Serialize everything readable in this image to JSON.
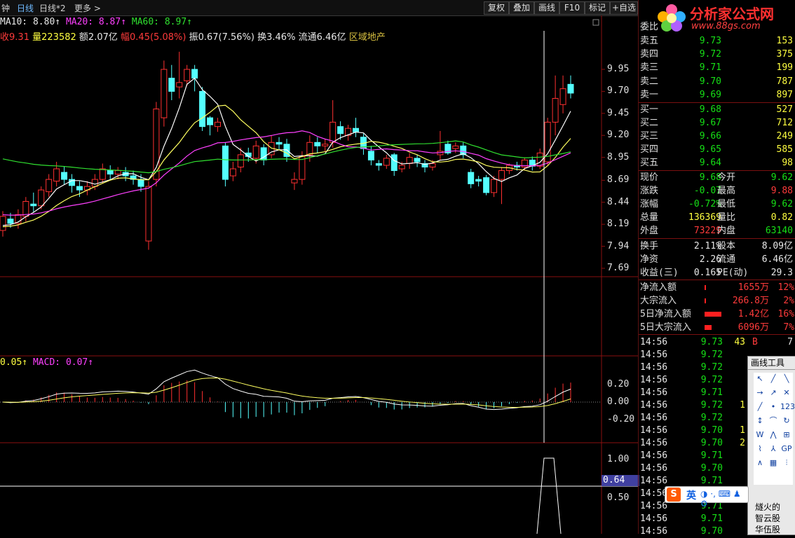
{
  "topbar": {
    "tab_minute": "钟",
    "tab_day": "日线",
    "tab_dayx2": "日线*2",
    "more": "更多 >",
    "buttons": [
      "复权",
      "叠加",
      "画线",
      "F10",
      "标记",
      "+自选"
    ]
  },
  "ma_line": {
    "ma10_label": "MA10:",
    "ma10_value": "8.80↑",
    "ma20_label": "MA20:",
    "ma20_value": "8.87↑",
    "ma60_label": "MA60:",
    "ma60_value": "8.97↑"
  },
  "stat_line": {
    "close_label": "收",
    "close_value": "9.31",
    "vol_label": "量",
    "vol_value": "223582",
    "amt_label": "额",
    "amt_value": "2.07亿",
    "chg_label": "幅",
    "chg_value": "0.45(5.08%)",
    "amp_label": "振",
    "amp_value": "0.67(7.56%)",
    "turn_label": "换",
    "turn_value": "3.46%",
    "float_label": "流通",
    "float_value": "6.46亿",
    "sector": "区域地产"
  },
  "macd_line": {
    "left": "0.05↑",
    "label": "MACD:",
    "value": "0.07↑"
  },
  "price_axis": [
    "9.95",
    "9.70",
    "9.45",
    "9.20",
    "8.95",
    "8.69",
    "8.44",
    "8.19",
    "7.94",
    "7.69"
  ],
  "macd_axis": [
    "0.20",
    "0.00",
    "-0.20"
  ],
  "bottom_axis": [
    "1.00",
    "0.64",
    "0.50"
  ],
  "logo": {
    "title": "分析家公式网",
    "url": "www.88gs.com"
  },
  "panel": {
    "header": "委比",
    "sells": [
      {
        "label": "卖五",
        "price": "9.73",
        "vol": "153"
      },
      {
        "label": "卖四",
        "price": "9.72",
        "vol": "375"
      },
      {
        "label": "卖三",
        "price": "9.71",
        "vol": "199"
      },
      {
        "label": "卖二",
        "price": "9.70",
        "vol": "787"
      },
      {
        "label": "卖一",
        "price": "9.69",
        "vol": "897"
      }
    ],
    "buys": [
      {
        "label": "买一",
        "price": "9.68",
        "vol": "527"
      },
      {
        "label": "买二",
        "price": "9.67",
        "vol": "712"
      },
      {
        "label": "买三",
        "price": "9.66",
        "vol": "249"
      },
      {
        "label": "买四",
        "price": "9.65",
        "vol": "585"
      },
      {
        "label": "买五",
        "price": "9.64",
        "vol": "98"
      }
    ],
    "quote": [
      {
        "l1": "现价",
        "v1": "9.68",
        "c1": "green",
        "l2": "今开",
        "v2": "9.62",
        "c2": "green"
      },
      {
        "l1": "涨跌",
        "v1": "-0.07",
        "c1": "green",
        "l2": "最高",
        "v2": "9.88",
        "c2": "red"
      },
      {
        "l1": "涨幅",
        "v1": "-0.72%",
        "c1": "green",
        "l2": "最低",
        "v2": "9.62",
        "c2": "green"
      },
      {
        "l1": "总量",
        "v1": "136369",
        "c1": "yellow",
        "l2": "量比",
        "v2": "0.82",
        "c2": "yellow"
      },
      {
        "l1": "外盘",
        "v1": "73229",
        "c1": "red",
        "l2": "内盘",
        "v2": "63140",
        "c2": "green"
      }
    ],
    "fund": [
      {
        "l1": "换手",
        "v1": "2.11%",
        "l2": "股本",
        "v2": "8.09亿"
      },
      {
        "l1": "净资",
        "v1": "2.26",
        "l2": "流通",
        "v2": "6.46亿"
      },
      {
        "l1": "收益(三)",
        "v1": "0.165",
        "l2": "PE(动)",
        "v2": "29.3"
      }
    ],
    "flows": [
      {
        "label": "净流入额",
        "value": "1655万",
        "pct": "12%"
      },
      {
        "label": "大宗流入",
        "value": "266.8万",
        "pct": "2%"
      },
      {
        "label": "5日净流入额",
        "value": "1.42亿",
        "pct": "16%"
      },
      {
        "label": "5日大宗流入",
        "value": "6096万",
        "pct": "7%"
      }
    ],
    "ticks": [
      {
        "t": "14:56",
        "p": "9.73",
        "v": "43",
        "f": "B",
        "e": "7"
      },
      {
        "t": "14:56",
        "p": "9.72",
        "v": "",
        "f": "",
        "e": ""
      },
      {
        "t": "14:56",
        "p": "9.72",
        "v": "",
        "f": "",
        "e": ""
      },
      {
        "t": "14:56",
        "p": "9.72",
        "v": "",
        "f": "",
        "e": ""
      },
      {
        "t": "14:56",
        "p": "9.71",
        "v": "",
        "f": "",
        "e": ""
      },
      {
        "t": "14:56",
        "p": "9.72",
        "v": "1",
        "f": "",
        "e": ""
      },
      {
        "t": "14:56",
        "p": "9.72",
        "v": "",
        "f": "",
        "e": ""
      },
      {
        "t": "14:56",
        "p": "9.70",
        "v": "1",
        "f": "",
        "e": ""
      },
      {
        "t": "14:56",
        "p": "9.70",
        "v": "2",
        "f": "",
        "e": ""
      },
      {
        "t": "14:56",
        "p": "9.71",
        "v": "",
        "f": "",
        "e": ""
      },
      {
        "t": "14:56",
        "p": "9.70",
        "v": "",
        "f": "",
        "e": ""
      },
      {
        "t": "14:56",
        "p": "9.71",
        "v": "",
        "f": "",
        "e": ""
      },
      {
        "t": "14:56",
        "p": "9.70",
        "v": "",
        "f": "",
        "e": ""
      },
      {
        "t": "14:56",
        "p": "9.71",
        "v": "",
        "f": "",
        "e": ""
      },
      {
        "t": "14:56",
        "p": "9.71",
        "v": "",
        "f": "",
        "e": ""
      },
      {
        "t": "14:56",
        "p": "9.70",
        "v": "",
        "f": "",
        "e": ""
      }
    ]
  },
  "toolbox": {
    "title": "画线工具",
    "stocks": [
      "燧火的",
      "智云股",
      "华伍股"
    ]
  },
  "ime": {
    "label": "英"
  },
  "chart_data": {
    "type": "candlestick",
    "price_axis_ticks": [
      9.95,
      9.7,
      9.45,
      9.2,
      8.95,
      8.69,
      8.44,
      8.19,
      7.94,
      7.69
    ],
    "ylim": [
      7.6,
      10.2
    ],
    "candles": [
      [
        8.12,
        8.28,
        8.05,
        8.34
      ],
      [
        8.25,
        8.2,
        8.15,
        8.32
      ],
      [
        8.2,
        8.3,
        8.14,
        8.36
      ],
      [
        8.28,
        8.45,
        8.22,
        8.5
      ],
      [
        8.42,
        8.4,
        8.32,
        8.55
      ],
      [
        8.4,
        8.58,
        8.36,
        8.62
      ],
      [
        8.56,
        8.7,
        8.5,
        8.76
      ],
      [
        8.68,
        8.82,
        8.62,
        8.9
      ],
      [
        8.78,
        8.7,
        8.64,
        8.85
      ],
      [
        8.7,
        8.63,
        8.55,
        8.76
      ],
      [
        8.62,
        8.58,
        8.5,
        8.68
      ],
      [
        8.58,
        8.62,
        8.52,
        8.68
      ],
      [
        8.62,
        8.7,
        8.58,
        8.76
      ],
      [
        8.7,
        8.82,
        8.66,
        8.88
      ],
      [
        8.8,
        8.76,
        8.7,
        8.86
      ],
      [
        8.76,
        8.8,
        8.7,
        8.84
      ],
      [
        8.78,
        8.74,
        8.68,
        8.84
      ],
      [
        8.74,
        8.7,
        8.64,
        8.8
      ],
      [
        8.7,
        8.62,
        8.56,
        8.76
      ],
      [
        8.0,
        8.62,
        7.9,
        8.68
      ],
      [
        8.7,
        9.5,
        8.62,
        9.58
      ],
      [
        9.4,
        9.95,
        9.3,
        10.05
      ],
      [
        9.85,
        9.7,
        9.6,
        10.0
      ],
      [
        9.75,
        9.8,
        9.62,
        10.15
      ],
      [
        9.82,
        9.95,
        9.76,
        10.0
      ],
      [
        9.95,
        9.85,
        9.7,
        10.0
      ],
      [
        9.7,
        9.3,
        9.25,
        9.75
      ],
      [
        9.4,
        9.32,
        9.2,
        9.42
      ],
      [
        9.3,
        9.35,
        9.24,
        9.4
      ],
      [
        9.08,
        8.7,
        8.62,
        9.12
      ],
      [
        8.74,
        8.82,
        8.68,
        8.9
      ],
      [
        8.84,
        8.98,
        8.78,
        9.06
      ],
      [
        9.0,
        8.96,
        8.9,
        9.06
      ],
      [
        8.94,
        9.08,
        8.88,
        9.14
      ],
      [
        9.06,
        8.92,
        8.86,
        9.1
      ],
      [
        8.98,
        9.12,
        8.94,
        9.2
      ],
      [
        9.12,
        9.1,
        9.04,
        9.18
      ],
      [
        9.1,
        8.96,
        8.9,
        9.16
      ],
      [
        8.66,
        8.7,
        8.58,
        8.78
      ],
      [
        8.7,
        8.96,
        8.64,
        9.02
      ],
      [
        8.98,
        9.12,
        8.9,
        9.2
      ],
      [
        9.12,
        9.08,
        9.0,
        9.18
      ],
      [
        9.08,
        9.1,
        9.02,
        9.16
      ],
      [
        9.12,
        9.35,
        9.06,
        9.6
      ],
      [
        9.3,
        9.22,
        9.15,
        9.36
      ],
      [
        9.2,
        9.28,
        9.14,
        9.32
      ],
      [
        9.28,
        9.24,
        9.18,
        9.4
      ],
      [
        9.18,
        9.05,
        8.98,
        9.22
      ],
      [
        9.02,
        8.92,
        8.86,
        9.08
      ],
      [
        8.88,
        8.86,
        8.8,
        8.92
      ],
      [
        8.86,
        8.94,
        8.82,
        8.98
      ],
      [
        8.98,
        8.8,
        8.74,
        9.0
      ],
      [
        8.82,
        8.86,
        8.78,
        8.9
      ],
      [
        8.88,
        8.95,
        8.82,
        9.0
      ],
      [
        8.94,
        8.9,
        8.84,
        8.98
      ],
      [
        8.88,
        8.84,
        8.78,
        8.92
      ],
      [
        8.84,
        8.88,
        8.8,
        8.92
      ],
      [
        8.98,
        9.02,
        8.92,
        9.25
      ],
      [
        9.1,
        9.0,
        8.98,
        9.14
      ],
      [
        9.05,
        9.08,
        9.0,
        9.12
      ],
      [
        9.08,
        8.98,
        8.94,
        9.12
      ],
      [
        8.78,
        8.65,
        8.6,
        8.82
      ],
      [
        8.7,
        8.68,
        8.62,
        8.74
      ],
      [
        8.72,
        8.55,
        8.52,
        8.75
      ],
      [
        8.55,
        8.7,
        8.5,
        8.74
      ],
      [
        8.7,
        8.8,
        8.42,
        8.84
      ],
      [
        8.8,
        8.86,
        8.76,
        8.88
      ],
      [
        8.86,
        8.84,
        8.8,
        8.9
      ],
      [
        8.84,
        8.92,
        8.8,
        8.95
      ],
      [
        8.92,
        8.85,
        8.8,
        8.96
      ],
      [
        8.85,
        9.0,
        8.82,
        9.05
      ],
      [
        8.9,
        9.35,
        8.86,
        9.4
      ],
      [
        9.35,
        9.62,
        9.2,
        9.88
      ],
      [
        9.55,
        9.73,
        9.45,
        9.88
      ],
      [
        9.78,
        9.68,
        9.62,
        9.88
      ]
    ],
    "ma_series": [
      {
        "name": "MA10"
      },
      {
        "name": "MA20"
      },
      {
        "name": "MA60"
      }
    ],
    "macd": {
      "ylim": [
        -0.32,
        0.32
      ]
    },
    "bottom": {
      "ylim": [
        0.3,
        1.1
      ]
    }
  }
}
